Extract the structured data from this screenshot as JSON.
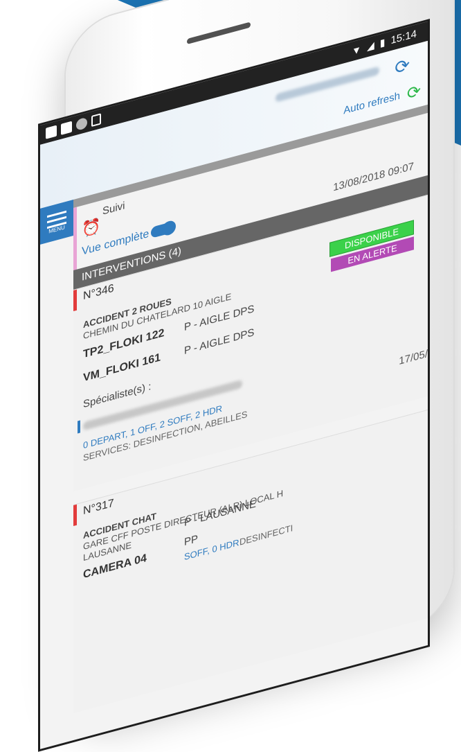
{
  "status_bar": {
    "time": "15:14"
  },
  "app": {
    "menu_label": "MENU",
    "auto_refresh_label": "Auto refresh",
    "suivi_label": "Suivi",
    "vue_label": "Vue complète",
    "last_update": "13/08/2018 09:07",
    "section_title": "INTERVENTIONS (4)"
  },
  "colors": {
    "brand_blue": "#1b74b5",
    "accent_blue": "#2f7bbf",
    "alert_red": "#e23b3b",
    "available_green": "#3bd14a",
    "alert_purple": "#b24ab5"
  },
  "icons": {
    "menu": "menu-icon",
    "refresh": "refresh-icon",
    "auto_refresh": "auto-refresh-icon",
    "alarm": "alarm-clock-icon"
  },
  "interventions": [
    {
      "number": "N°346",
      "title": "ACCIDENT 2 ROUES",
      "address": "CHEMIN DU CHATELARD 10 AIGLE",
      "badges": [
        "DISPONIBLE",
        "EN ALERTE"
      ],
      "vehicles": [
        {
          "name": "TP2_FLOKI 122",
          "post": "P - AIGLE DPS"
        },
        {
          "name": "VM_FLOKI 161",
          "post": "P - AIGLE DPS"
        }
      ],
      "specialist_label": "Spécialiste(s) :",
      "staff": "0 DEPART, 1 OFF, 2 SOFF, 2 HDR",
      "services": "SERVICES: DESINFECTION, ABEILLES",
      "date": "17/05/"
    },
    {
      "number": "N°317",
      "title": "ACCIDENT CHAT",
      "address": "GARE CFF POSTE DIRECTEUR (ALR) LOCAL H",
      "city": "LAUSANNE",
      "vehicles": [
        {
          "name": "CAMERA 04",
          "post": "P - LAUSANNE"
        },
        {
          "name": "",
          "post": "PP"
        }
      ],
      "staff": "SOFF, 0 HDR",
      "services": "DESINFECTI"
    }
  ]
}
